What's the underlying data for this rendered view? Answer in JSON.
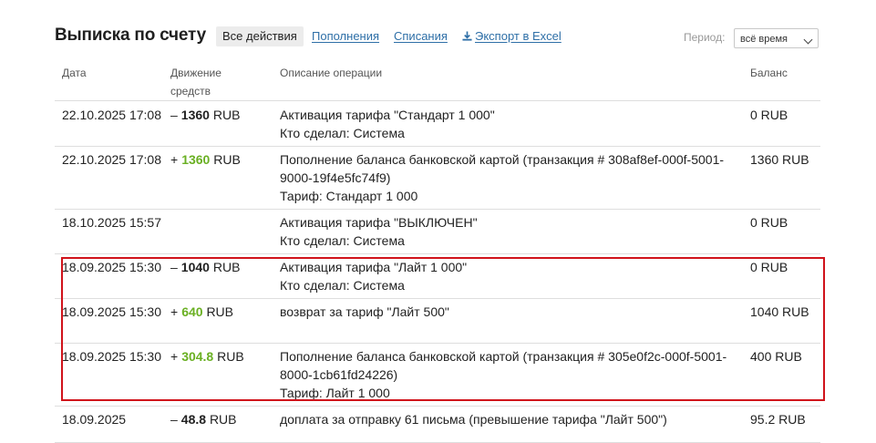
{
  "header": {
    "title": "Выписка по счету",
    "tabs": [
      {
        "label": "Все действия",
        "active": true
      },
      {
        "label": "Пополнения",
        "active": false
      },
      {
        "label": "Списания",
        "active": false
      },
      {
        "label": "Экспорт в Excel",
        "active": false,
        "icon": "download-icon"
      }
    ],
    "period_label": "Период:",
    "period_value": "всё время"
  },
  "table": {
    "columns": [
      "Дата",
      "Движение средств",
      "Описание операции",
      "Баланс"
    ],
    "rows": [
      {
        "date": "22.10.2025 17:08",
        "sign": "–",
        "amount": "1360",
        "currency": "RUB",
        "direction": "debit",
        "desc": [
          "Активация тарифа \"Стандарт 1 000\"",
          "Кто сделал: Система"
        ],
        "balance": "0 RUB"
      },
      {
        "date": "22.10.2025 17:08",
        "sign": "+",
        "amount": "1360",
        "currency": "RUB",
        "direction": "credit",
        "desc": [
          "Пополнение баланса банковской картой (транзакция # 308af8ef-000f-5001-9000-19f4e5fc74f9)",
          "Тариф: Стандарт 1 000"
        ],
        "balance": "1360 RUB"
      },
      {
        "date": "18.10.2025 15:57",
        "sign": "",
        "amount": "",
        "currency": "",
        "direction": "none",
        "desc": [
          "Активация тарифа \"ВЫКЛЮЧЕН\"",
          "Кто сделал: Система"
        ],
        "balance": "0 RUB"
      },
      {
        "date": "18.09.2025 15:30",
        "sign": "–",
        "amount": "1040",
        "currency": "RUB",
        "direction": "debit",
        "desc": [
          "Активация тарифа \"Лайт 1 000\"",
          "Кто сделал: Система"
        ],
        "balance": "0 RUB"
      },
      {
        "date": "18.09.2025 15:30",
        "sign": "+",
        "amount": "640",
        "currency": "RUB",
        "direction": "credit",
        "desc": [
          "возврат за тариф \"Лайт 500\""
        ],
        "balance": "1040 RUB"
      },
      {
        "date": "18.09.2025 15:30",
        "sign": "+",
        "amount": "304.8",
        "currency": "RUB",
        "direction": "credit",
        "desc": [
          "Пополнение баланса банковской картой (транзакция # 305e0f2c-000f-5001-8000-1cb61fd24226)",
          "Тариф: Лайт 1 000"
        ],
        "balance": "400 RUB"
      },
      {
        "date": "18.09.2025",
        "sign": "–",
        "amount": "48.8",
        "currency": "RUB",
        "direction": "debit",
        "desc": [
          "доплата за отправку 61 письма (превышение тарифа \"Лайт 500\")"
        ],
        "balance": "95.2 RUB"
      }
    ]
  },
  "colors": {
    "link": "#2e6fa7",
    "credit": "#6ab023",
    "highlight": "#d0131b"
  }
}
